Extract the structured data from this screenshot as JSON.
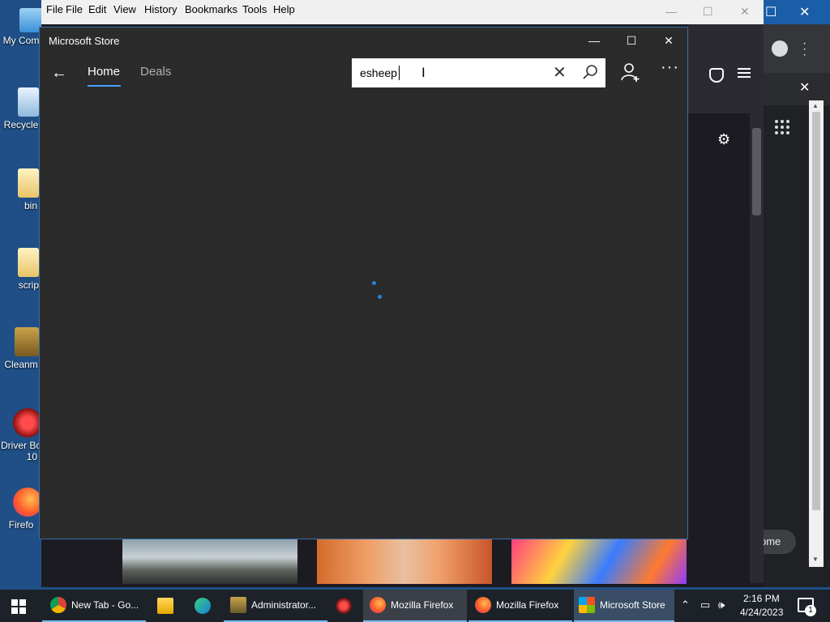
{
  "desktop": {
    "icons": [
      {
        "label": "My Com",
        "icon": "computer-icon"
      },
      {
        "label": "Recycle",
        "icon": "recycle-bin-icon"
      },
      {
        "label": "bin",
        "icon": "folder-icon"
      },
      {
        "label": "scrip",
        "icon": "folder-icon"
      },
      {
        "label": "Cleanm",
        "icon": "cleanmgr-icon"
      },
      {
        "label": "Driver Bo",
        "label2": "10",
        "icon": "driver-booster-icon"
      },
      {
        "label": "Firefo",
        "icon": "firefox-icon"
      }
    ]
  },
  "firefox": {
    "menu": [
      "File",
      "File",
      "Edit",
      "View",
      "History",
      "Bookmarks",
      "Tools",
      "Help"
    ]
  },
  "chrome": {
    "home_label": "ome"
  },
  "store": {
    "title": "Microsoft Store",
    "tabs": [
      {
        "label": "Home",
        "selected": true
      },
      {
        "label": "Deals",
        "selected": false
      }
    ],
    "search": {
      "value": "esheep"
    },
    "accent": "#4aa0ff",
    "spinner_color": "#2d7fd8"
  },
  "taskbar": {
    "items": [
      {
        "label": "New Tab - Go...",
        "icon": "chrome-icon",
        "state": "open"
      },
      {
        "label": "",
        "icon": "file-explorer-icon",
        "state": "none"
      },
      {
        "label": "",
        "icon": "edge-icon",
        "state": "none"
      },
      {
        "label": "Administrator...",
        "icon": "terminal-icon",
        "state": "open"
      },
      {
        "label": "",
        "icon": "driver-booster-icon",
        "state": "none"
      },
      {
        "label": "Mozilla Firefox",
        "icon": "firefox-icon",
        "state": "open-highlight"
      },
      {
        "label": "Mozilla Firefox",
        "icon": "firefox-icon",
        "state": "open"
      },
      {
        "label": "Microsoft Store",
        "icon": "store-icon",
        "state": "active"
      }
    ],
    "clock": {
      "time": "2:16 PM",
      "date": "4/24/2023"
    },
    "notification_count": "1"
  }
}
